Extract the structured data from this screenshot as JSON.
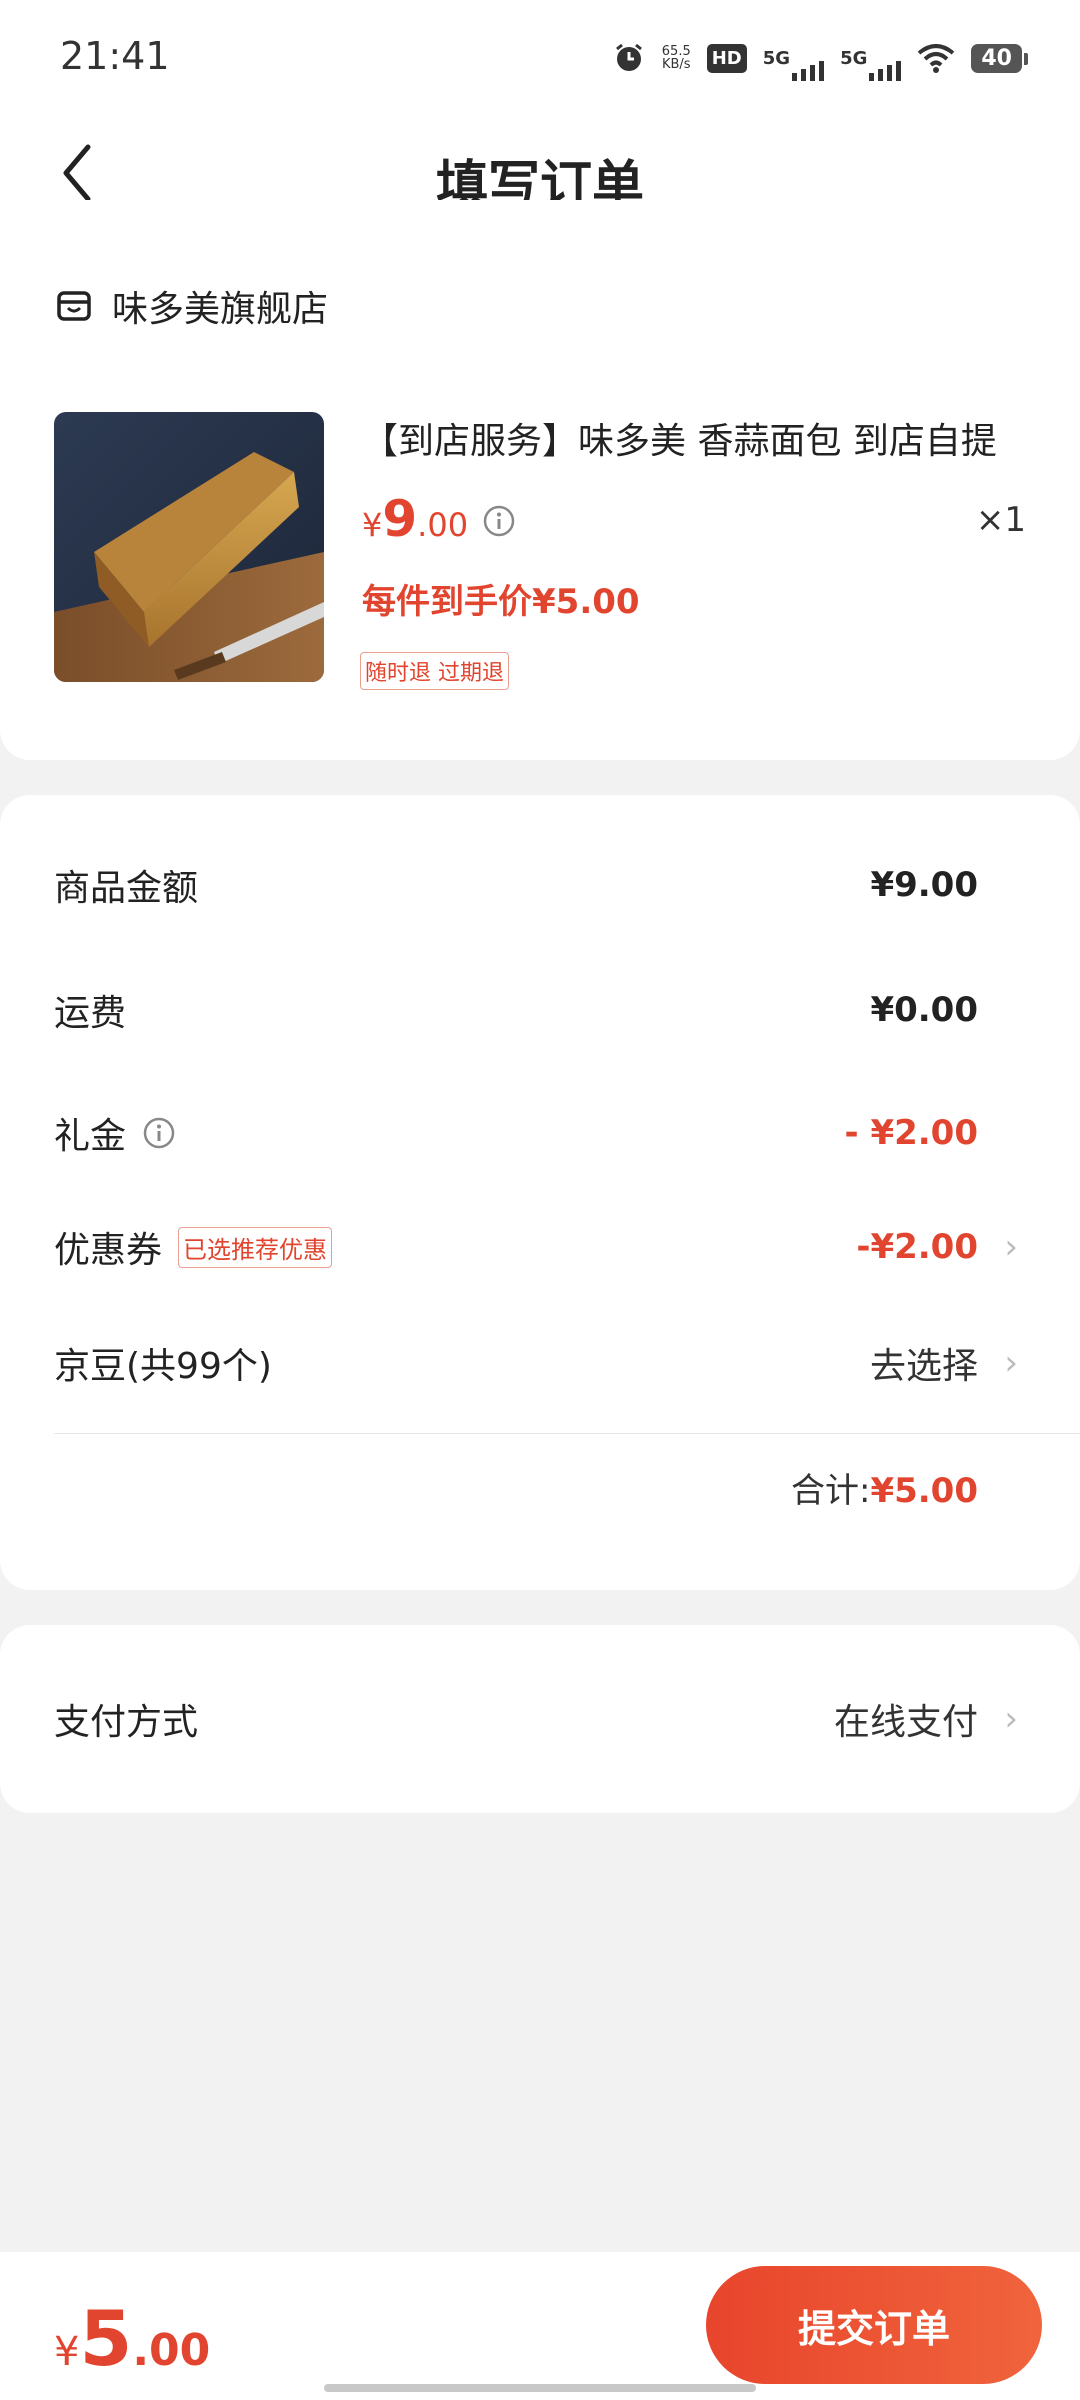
{
  "status_bar": {
    "time": "21:41",
    "net_speed_value": "65.5",
    "net_speed_unit": "KB/s",
    "hd_label": "HD",
    "signal1_label": "5G",
    "signal2_label": "5G",
    "battery": "40"
  },
  "header": {
    "title": "填写订单"
  },
  "store": {
    "name": "味多美旗舰店"
  },
  "product": {
    "title": "【到店服务】味多美 香蒜面包  到店自提",
    "price_symbol": "¥",
    "price_int": "9",
    "price_dec": ".00",
    "quantity": "×1",
    "per_item_price": "每件到手价¥5.00",
    "tag": "随时退 过期退"
  },
  "summary": {
    "goods_amount_label": "商品金额",
    "goods_amount_value": "¥9.00",
    "shipping_label": "运费",
    "shipping_value": "¥0.00",
    "gift_label": "礼金",
    "gift_value": "- ¥2.00",
    "coupon_label": "优惠券",
    "coupon_tag": "已选推荐优惠",
    "coupon_value": "-¥2.00",
    "jingdou_label": "京豆(共99个)",
    "jingdou_value": "去选择",
    "total_label": "合计:",
    "total_value": "¥5.00"
  },
  "payment": {
    "label": "支付方式",
    "value": "在线支付"
  },
  "bottom_bar": {
    "price_symbol": "¥",
    "price_int": "5",
    "price_dec": ".00",
    "submit_label": "提交订单"
  },
  "colors": {
    "accent": "#e2452f",
    "background": "#f2f2f2"
  }
}
